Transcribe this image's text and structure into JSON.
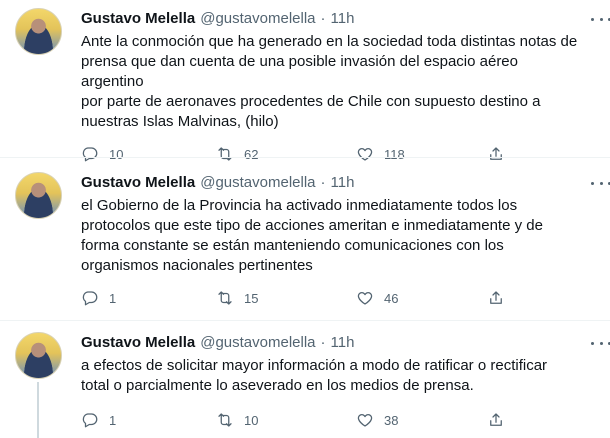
{
  "tweets": [
    {
      "name": "Gustavo Melella",
      "handle": "@gustavomelella",
      "dot": "·",
      "time": "11h",
      "text": "Ante la conmoción que ha generado en la sociedad toda distintas notas de\nprensa que dan cuenta de una posible invasión del espacio aéreo argentino\npor parte de aeronaves procedentes de Chile con supuesto destino a\nnuestras Islas Malvinas, (hilo)",
      "replies": "10",
      "retweets": "62",
      "likes": "118"
    },
    {
      "name": "Gustavo Melella",
      "handle": "@gustavomelella",
      "dot": "·",
      "time": "11h",
      "text": "el Gobierno de la Provincia ha activado inmediatamente todos los\nprotocolos que este tipo de acciones ameritan e inmediatamente y de\nforma constante se están manteniendo comunicaciones con los\norganismos nacionales pertinentes",
      "replies": "1",
      "retweets": "15",
      "likes": "46"
    },
    {
      "name": "Gustavo Melella",
      "handle": "@gustavomelella",
      "dot": "·",
      "time": "11h",
      "text": "a efectos de solicitar mayor información a modo de ratificar o rectificar\ntotal o parcialmente lo aseverado en los medios de prensa.",
      "replies": "1",
      "retweets": "10",
      "likes": "38"
    }
  ],
  "icons": {
    "reply": "reply-icon",
    "retweet": "retweet-icon",
    "like": "heart-icon",
    "share": "share-icon",
    "more": "more-dots-icon"
  }
}
